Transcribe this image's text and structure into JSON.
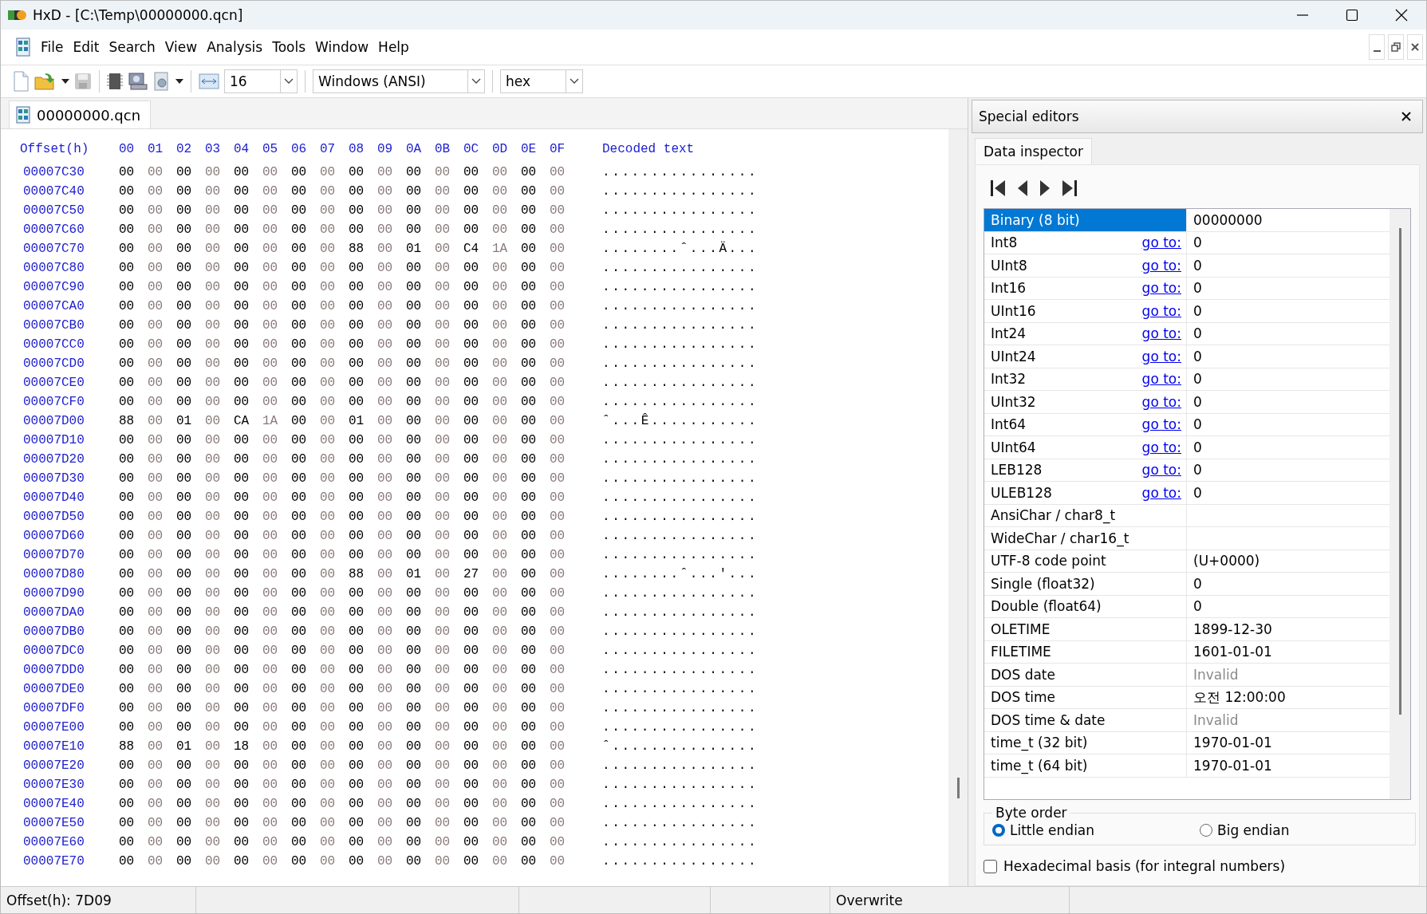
{
  "window": {
    "title": "HxD - [C:\\Temp\\00000000.qcn]"
  },
  "menu": [
    "File",
    "Edit",
    "Search",
    "View",
    "Analysis",
    "Tools",
    "Window",
    "Help"
  ],
  "toolbar": {
    "bytes_per_row": "16",
    "charset": "Windows (ANSI)",
    "offset_base": "hex"
  },
  "document_tabs": [
    {
      "label": "00000000.qcn",
      "selected": true
    }
  ],
  "hex_view": {
    "header": {
      "offset": "Offset(h)",
      "columns": [
        "00",
        "01",
        "02",
        "03",
        "04",
        "05",
        "06",
        "07",
        "08",
        "09",
        "0A",
        "0B",
        "0C",
        "0D",
        "0E",
        "0F"
      ],
      "decoded": "Decoded text"
    },
    "rows": [
      {
        "offset": "00007C30",
        "bytes": [
          "00",
          "00",
          "00",
          "00",
          "00",
          "00",
          "00",
          "00",
          "00",
          "00",
          "00",
          "00",
          "00",
          "00",
          "00",
          "00"
        ],
        "text": "................"
      },
      {
        "offset": "00007C40",
        "bytes": [
          "00",
          "00",
          "00",
          "00",
          "00",
          "00",
          "00",
          "00",
          "00",
          "00",
          "00",
          "00",
          "00",
          "00",
          "00",
          "00"
        ],
        "text": "................"
      },
      {
        "offset": "00007C50",
        "bytes": [
          "00",
          "00",
          "00",
          "00",
          "00",
          "00",
          "00",
          "00",
          "00",
          "00",
          "00",
          "00",
          "00",
          "00",
          "00",
          "00"
        ],
        "text": "................"
      },
      {
        "offset": "00007C60",
        "bytes": [
          "00",
          "00",
          "00",
          "00",
          "00",
          "00",
          "00",
          "00",
          "00",
          "00",
          "00",
          "00",
          "00",
          "00",
          "00",
          "00"
        ],
        "text": "................"
      },
      {
        "offset": "00007C70",
        "bytes": [
          "00",
          "00",
          "00",
          "00",
          "00",
          "00",
          "00",
          "00",
          "88",
          "00",
          "01",
          "00",
          "C4",
          "1A",
          "00",
          "00"
        ],
        "text": "........ˆ...Ä..."
      },
      {
        "offset": "00007C80",
        "bytes": [
          "00",
          "00",
          "00",
          "00",
          "00",
          "00",
          "00",
          "00",
          "00",
          "00",
          "00",
          "00",
          "00",
          "00",
          "00",
          "00"
        ],
        "text": "................"
      },
      {
        "offset": "00007C90",
        "bytes": [
          "00",
          "00",
          "00",
          "00",
          "00",
          "00",
          "00",
          "00",
          "00",
          "00",
          "00",
          "00",
          "00",
          "00",
          "00",
          "00"
        ],
        "text": "................"
      },
      {
        "offset": "00007CA0",
        "bytes": [
          "00",
          "00",
          "00",
          "00",
          "00",
          "00",
          "00",
          "00",
          "00",
          "00",
          "00",
          "00",
          "00",
          "00",
          "00",
          "00"
        ],
        "text": "................"
      },
      {
        "offset": "00007CB0",
        "bytes": [
          "00",
          "00",
          "00",
          "00",
          "00",
          "00",
          "00",
          "00",
          "00",
          "00",
          "00",
          "00",
          "00",
          "00",
          "00",
          "00"
        ],
        "text": "................"
      },
      {
        "offset": "00007CC0",
        "bytes": [
          "00",
          "00",
          "00",
          "00",
          "00",
          "00",
          "00",
          "00",
          "00",
          "00",
          "00",
          "00",
          "00",
          "00",
          "00",
          "00"
        ],
        "text": "................"
      },
      {
        "offset": "00007CD0",
        "bytes": [
          "00",
          "00",
          "00",
          "00",
          "00",
          "00",
          "00",
          "00",
          "00",
          "00",
          "00",
          "00",
          "00",
          "00",
          "00",
          "00"
        ],
        "text": "................"
      },
      {
        "offset": "00007CE0",
        "bytes": [
          "00",
          "00",
          "00",
          "00",
          "00",
          "00",
          "00",
          "00",
          "00",
          "00",
          "00",
          "00",
          "00",
          "00",
          "00",
          "00"
        ],
        "text": "................"
      },
      {
        "offset": "00007CF0",
        "bytes": [
          "00",
          "00",
          "00",
          "00",
          "00",
          "00",
          "00",
          "00",
          "00",
          "00",
          "00",
          "00",
          "00",
          "00",
          "00",
          "00"
        ],
        "text": "................"
      },
      {
        "offset": "00007D00",
        "bytes": [
          "88",
          "00",
          "01",
          "00",
          "CA",
          "1A",
          "00",
          "00",
          "01",
          "00",
          "00",
          "00",
          "00",
          "00",
          "00",
          "00"
        ],
        "text": "ˆ...Ê..........."
      },
      {
        "offset": "00007D10",
        "bytes": [
          "00",
          "00",
          "00",
          "00",
          "00",
          "00",
          "00",
          "00",
          "00",
          "00",
          "00",
          "00",
          "00",
          "00",
          "00",
          "00"
        ],
        "text": "................"
      },
      {
        "offset": "00007D20",
        "bytes": [
          "00",
          "00",
          "00",
          "00",
          "00",
          "00",
          "00",
          "00",
          "00",
          "00",
          "00",
          "00",
          "00",
          "00",
          "00",
          "00"
        ],
        "text": "................"
      },
      {
        "offset": "00007D30",
        "bytes": [
          "00",
          "00",
          "00",
          "00",
          "00",
          "00",
          "00",
          "00",
          "00",
          "00",
          "00",
          "00",
          "00",
          "00",
          "00",
          "00"
        ],
        "text": "................"
      },
      {
        "offset": "00007D40",
        "bytes": [
          "00",
          "00",
          "00",
          "00",
          "00",
          "00",
          "00",
          "00",
          "00",
          "00",
          "00",
          "00",
          "00",
          "00",
          "00",
          "00"
        ],
        "text": "................"
      },
      {
        "offset": "00007D50",
        "bytes": [
          "00",
          "00",
          "00",
          "00",
          "00",
          "00",
          "00",
          "00",
          "00",
          "00",
          "00",
          "00",
          "00",
          "00",
          "00",
          "00"
        ],
        "text": "................"
      },
      {
        "offset": "00007D60",
        "bytes": [
          "00",
          "00",
          "00",
          "00",
          "00",
          "00",
          "00",
          "00",
          "00",
          "00",
          "00",
          "00",
          "00",
          "00",
          "00",
          "00"
        ],
        "text": "................"
      },
      {
        "offset": "00007D70",
        "bytes": [
          "00",
          "00",
          "00",
          "00",
          "00",
          "00",
          "00",
          "00",
          "00",
          "00",
          "00",
          "00",
          "00",
          "00",
          "00",
          "00"
        ],
        "text": "................"
      },
      {
        "offset": "00007D80",
        "bytes": [
          "00",
          "00",
          "00",
          "00",
          "00",
          "00",
          "00",
          "00",
          "88",
          "00",
          "01",
          "00",
          "27",
          "00",
          "00",
          "00"
        ],
        "text": "........ˆ...'..."
      },
      {
        "offset": "00007D90",
        "bytes": [
          "00",
          "00",
          "00",
          "00",
          "00",
          "00",
          "00",
          "00",
          "00",
          "00",
          "00",
          "00",
          "00",
          "00",
          "00",
          "00"
        ],
        "text": "................"
      },
      {
        "offset": "00007DA0",
        "bytes": [
          "00",
          "00",
          "00",
          "00",
          "00",
          "00",
          "00",
          "00",
          "00",
          "00",
          "00",
          "00",
          "00",
          "00",
          "00",
          "00"
        ],
        "text": "................"
      },
      {
        "offset": "00007DB0",
        "bytes": [
          "00",
          "00",
          "00",
          "00",
          "00",
          "00",
          "00",
          "00",
          "00",
          "00",
          "00",
          "00",
          "00",
          "00",
          "00",
          "00"
        ],
        "text": "................"
      },
      {
        "offset": "00007DC0",
        "bytes": [
          "00",
          "00",
          "00",
          "00",
          "00",
          "00",
          "00",
          "00",
          "00",
          "00",
          "00",
          "00",
          "00",
          "00",
          "00",
          "00"
        ],
        "text": "................"
      },
      {
        "offset": "00007DD0",
        "bytes": [
          "00",
          "00",
          "00",
          "00",
          "00",
          "00",
          "00",
          "00",
          "00",
          "00",
          "00",
          "00",
          "00",
          "00",
          "00",
          "00"
        ],
        "text": "................"
      },
      {
        "offset": "00007DE0",
        "bytes": [
          "00",
          "00",
          "00",
          "00",
          "00",
          "00",
          "00",
          "00",
          "00",
          "00",
          "00",
          "00",
          "00",
          "00",
          "00",
          "00"
        ],
        "text": "................"
      },
      {
        "offset": "00007DF0",
        "bytes": [
          "00",
          "00",
          "00",
          "00",
          "00",
          "00",
          "00",
          "00",
          "00",
          "00",
          "00",
          "00",
          "00",
          "00",
          "00",
          "00"
        ],
        "text": "................"
      },
      {
        "offset": "00007E00",
        "bytes": [
          "00",
          "00",
          "00",
          "00",
          "00",
          "00",
          "00",
          "00",
          "00",
          "00",
          "00",
          "00",
          "00",
          "00",
          "00",
          "00"
        ],
        "text": "................"
      },
      {
        "offset": "00007E10",
        "bytes": [
          "88",
          "00",
          "01",
          "00",
          "18",
          "00",
          "00",
          "00",
          "00",
          "00",
          "00",
          "00",
          "00",
          "00",
          "00",
          "00"
        ],
        "text": "ˆ..............."
      },
      {
        "offset": "00007E20",
        "bytes": [
          "00",
          "00",
          "00",
          "00",
          "00",
          "00",
          "00",
          "00",
          "00",
          "00",
          "00",
          "00",
          "00",
          "00",
          "00",
          "00"
        ],
        "text": "................"
      },
      {
        "offset": "00007E30",
        "bytes": [
          "00",
          "00",
          "00",
          "00",
          "00",
          "00",
          "00",
          "00",
          "00",
          "00",
          "00",
          "00",
          "00",
          "00",
          "00",
          "00"
        ],
        "text": "................"
      },
      {
        "offset": "00007E40",
        "bytes": [
          "00",
          "00",
          "00",
          "00",
          "00",
          "00",
          "00",
          "00",
          "00",
          "00",
          "00",
          "00",
          "00",
          "00",
          "00",
          "00"
        ],
        "text": "................"
      },
      {
        "offset": "00007E50",
        "bytes": [
          "00",
          "00",
          "00",
          "00",
          "00",
          "00",
          "00",
          "00",
          "00",
          "00",
          "00",
          "00",
          "00",
          "00",
          "00",
          "00"
        ],
        "text": "................"
      },
      {
        "offset": "00007E60",
        "bytes": [
          "00",
          "00",
          "00",
          "00",
          "00",
          "00",
          "00",
          "00",
          "00",
          "00",
          "00",
          "00",
          "00",
          "00",
          "00",
          "00"
        ],
        "text": "................"
      },
      {
        "offset": "00007E70",
        "bytes": [
          "00",
          "00",
          "00",
          "00",
          "00",
          "00",
          "00",
          "00",
          "00",
          "00",
          "00",
          "00",
          "00",
          "00",
          "00",
          "00"
        ],
        "text": "................"
      }
    ]
  },
  "special_editors": {
    "title": "Special editors",
    "tabs": [
      {
        "label": "Data inspector",
        "selected": true
      }
    ],
    "rows": [
      {
        "label": "Binary (8 bit)",
        "value": "00000000",
        "selected": true,
        "greyed": false
      },
      {
        "label": "Int8",
        "link": "go to:",
        "value": "0",
        "selected": false,
        "greyed": false
      },
      {
        "label": "UInt8",
        "link": "go to:",
        "value": "0",
        "selected": false,
        "greyed": false
      },
      {
        "label": "Int16",
        "link": "go to:",
        "value": "0",
        "selected": false,
        "greyed": false
      },
      {
        "label": "UInt16",
        "link": "go to:",
        "value": "0",
        "selected": false,
        "greyed": false
      },
      {
        "label": "Int24",
        "link": "go to:",
        "value": "0",
        "selected": false,
        "greyed": false
      },
      {
        "label": "UInt24",
        "link": "go to:",
        "value": "0",
        "selected": false,
        "greyed": false
      },
      {
        "label": "Int32",
        "link": "go to:",
        "value": "0",
        "selected": false,
        "greyed": false
      },
      {
        "label": "UInt32",
        "link": "go to:",
        "value": "0",
        "selected": false,
        "greyed": false
      },
      {
        "label": "Int64",
        "link": "go to:",
        "value": "0",
        "selected": false,
        "greyed": false
      },
      {
        "label": "UInt64",
        "link": "go to:",
        "value": "0",
        "selected": false,
        "greyed": false
      },
      {
        "label": "LEB128",
        "link": "go to:",
        "value": "0",
        "selected": false,
        "greyed": false
      },
      {
        "label": "ULEB128",
        "link": "go to:",
        "value": "0",
        "selected": false,
        "greyed": false
      },
      {
        "label": "AnsiChar / char8_t",
        "selected": false
      },
      {
        "label": "WideChar / char16_t",
        "selected": false
      },
      {
        "label": "UTF-8 code point",
        "value": "(U+0000)",
        "selected": false,
        "greyed": false
      },
      {
        "label": "Single (float32)",
        "value": "0",
        "selected": false,
        "greyed": false
      },
      {
        "label": "Double (float64)",
        "value": "0",
        "selected": false,
        "greyed": false
      },
      {
        "label": "OLETIME",
        "value": "1899-12-30",
        "selected": false,
        "greyed": false
      },
      {
        "label": "FILETIME",
        "value": "1601-01-01",
        "selected": false,
        "greyed": false
      },
      {
        "label": "DOS date",
        "value": "Invalid",
        "selected": false,
        "greyed": true
      },
      {
        "label": "DOS time",
        "value": "오전 12:00:00",
        "selected": false,
        "greyed": false
      },
      {
        "label": "DOS time & date",
        "value": "Invalid",
        "selected": false,
        "greyed": true
      },
      {
        "label": "time_t (32 bit)",
        "value": "1970-01-01",
        "selected": false,
        "greyed": false
      },
      {
        "label": "time_t (64 bit)",
        "value": "1970-01-01",
        "selected": false,
        "greyed": false
      }
    ],
    "byte_order": {
      "title": "Byte order",
      "options": [
        {
          "label": "Little endian",
          "selected": true
        },
        {
          "label": "Big endian",
          "selected": false
        }
      ]
    },
    "hex_basis": {
      "label": "Hexadecimal basis (for integral numbers)",
      "checked": false
    }
  },
  "status_bar": {
    "position": "Offset(h): 7D09",
    "mode": "Overwrite"
  }
}
